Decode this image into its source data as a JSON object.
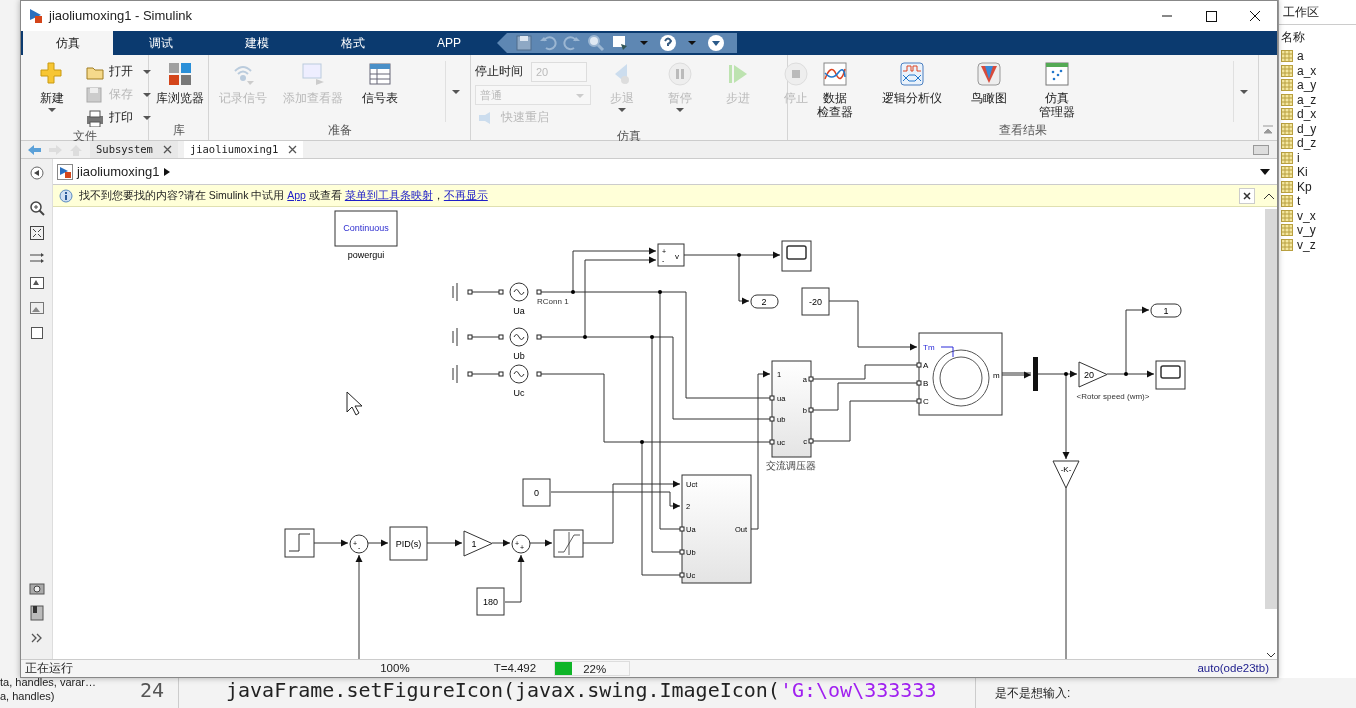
{
  "window": {
    "title": "jiaoliumoxing1 - Simulink"
  },
  "ribbon_tabs": [
    {
      "label": "仿真",
      "selected": true
    },
    {
      "label": "调试",
      "selected": false
    },
    {
      "label": "建模",
      "selected": false
    },
    {
      "label": "格式",
      "selected": false
    },
    {
      "label": "APP",
      "selected": false
    }
  ],
  "ribbon_groups": [
    {
      "label": "文件",
      "items": [
        {
          "kind": "large",
          "label": "新建",
          "disabled": false,
          "menu": true
        },
        {
          "kind": "small",
          "label": "打开",
          "disabled": false,
          "menu": true
        },
        {
          "kind": "small",
          "label": "保存",
          "disabled": true,
          "menu": true
        },
        {
          "kind": "small",
          "label": "打印",
          "disabled": false,
          "menu": true
        }
      ]
    },
    {
      "label": "库",
      "items": [
        {
          "kind": "large",
          "label": "库浏览器",
          "disabled": false,
          "menu": false
        }
      ]
    },
    {
      "label": "准备",
      "items": [
        {
          "kind": "large",
          "label": "记录信号",
          "disabled": true,
          "menu": false
        },
        {
          "kind": "large",
          "label": "添加查看器",
          "disabled": true,
          "menu": false
        },
        {
          "kind": "large",
          "label": "信号表",
          "disabled": false,
          "menu": false
        },
        {
          "kind": "more"
        }
      ]
    },
    {
      "label": "仿真",
      "items": [
        {
          "kind": "field",
          "label": "停止时间",
          "value": "20",
          "disabled": true
        },
        {
          "kind": "dropdown",
          "value": "普通",
          "disabled": true
        },
        {
          "kind": "small",
          "label": "快速重启",
          "disabled": true,
          "menu": false
        },
        {
          "kind": "large",
          "label": "步退",
          "disabled": true,
          "menu": true
        },
        {
          "kind": "large",
          "label": "暂停",
          "disabled": true,
          "menu": true
        },
        {
          "kind": "large",
          "label": "步进",
          "disabled": true,
          "menu": false
        },
        {
          "kind": "large",
          "label": "停止",
          "disabled": true,
          "menu": false
        }
      ]
    },
    {
      "label": "查看结果",
      "items": [
        {
          "kind": "large",
          "lines": [
            "数据",
            "检查器"
          ],
          "disabled": false,
          "menu": false
        },
        {
          "kind": "large",
          "label": "逻辑分析仪",
          "disabled": false,
          "menu": false
        },
        {
          "kind": "large",
          "label": "鸟瞰图",
          "disabled": false,
          "menu": false
        },
        {
          "kind": "large",
          "lines": [
            "仿真",
            "管理器"
          ],
          "disabled": false,
          "menu": false
        },
        {
          "kind": "more"
        }
      ]
    }
  ],
  "doc_tabs": [
    {
      "label": "Subsystem",
      "selected": false
    },
    {
      "label": "jiaoliumoxing1",
      "selected": true
    }
  ],
  "breadcrumb": "jiaoliumoxing1",
  "info_bar": [
    {
      "kind": "text",
      "text": "找不到您要找的内容?请在 Simulink 中试用 "
    },
    {
      "kind": "link",
      "text": "App"
    },
    {
      "kind": "text",
      "text": " 或查看 "
    },
    {
      "kind": "link",
      "text": "菜单到工具条映射"
    },
    {
      "kind": "text",
      "text": "，"
    },
    {
      "kind": "link",
      "text": "不再显示"
    }
  ],
  "diagram": {
    "powergui": {
      "text": "Continuous",
      "label": "powergui"
    },
    "sources": [
      {
        "label": "Ua",
        "port_note": "RConn 1"
      },
      {
        "label": "Ub"
      },
      {
        "label": "Uc"
      }
    ],
    "measurement": {
      "inputs": [
        "+",
        "-"
      ],
      "output": "v"
    },
    "goto": {
      "text": "2"
    },
    "constants": [
      {
        "text": "-20"
      },
      {
        "text": "0"
      },
      {
        "text": "180"
      }
    ],
    "regulator": {
      "label": "交流调压器",
      "inputs": [
        "1",
        "ua",
        "ub",
        "uc"
      ],
      "outputs": [
        "a",
        "b",
        "c"
      ]
    },
    "machine": {
      "inputs": [
        "Tm",
        "A",
        "B",
        "C"
      ],
      "output": "m"
    },
    "bus_signal": "<Rotor speed (wm)>",
    "gains": [
      {
        "text": "20"
      },
      {
        "text": "-K-"
      },
      {
        "text": "1"
      }
    ],
    "outport": {
      "text": "1"
    },
    "pid": {
      "text": "PID(s)"
    },
    "sums": [
      {
        "signs": [
          "+",
          "-"
        ]
      },
      {
        "signs": [
          "+",
          "+"
        ]
      }
    ],
    "subsystem": {
      "inputs": [
        "Uct",
        "2",
        "Ua",
        "Ub",
        "Uc"
      ],
      "output": "Out"
    }
  },
  "status_bar": {
    "state": "正在运行",
    "zoom": "100%",
    "time": "T=4.492",
    "progress": {
      "level": 0.22,
      "text": "22%"
    },
    "solver": "auto(ode23tb)"
  },
  "workspace": {
    "title": "工作区",
    "column": "名称",
    "variables": [
      "a",
      "a_x",
      "a_y",
      "a_z",
      "d_x",
      "d_y",
      "d_z",
      "i",
      "Ki",
      "Kp",
      "t",
      "v_x",
      "v_y",
      "v_z"
    ]
  },
  "background": {
    "left_lines": [
      "ta, handles, varar…",
      "a, handles)"
    ],
    "line_number": "24",
    "code": "javaFrame.setFigureIcon(javax.swing.ImageIcon(",
    "code_string": "'G:\\ow\\333333",
    "console": "是不是想输入:"
  }
}
